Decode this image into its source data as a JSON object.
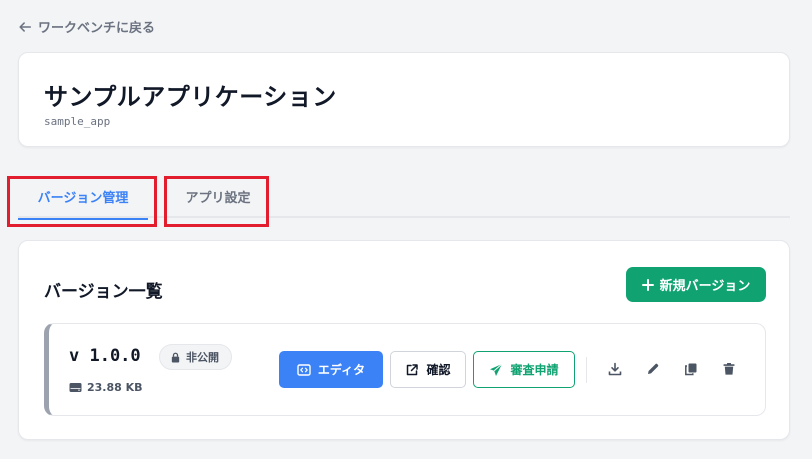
{
  "nav": {
    "back_label": "ワークベンチに戻る"
  },
  "app": {
    "title": "サンプルアプリケーション",
    "id": "sample_app"
  },
  "tabs": [
    {
      "label": "バージョン管理",
      "active": true
    },
    {
      "label": "アプリ設定",
      "active": false
    }
  ],
  "versions_section": {
    "title": "バージョン一覧",
    "new_button_label": "新規バージョン",
    "items": [
      {
        "version": "v 1.0.0",
        "status": "非公開",
        "size": "23.88 KB",
        "actions": {
          "editor": "エディタ",
          "preview": "確認",
          "review": "審査申請"
        }
      }
    ]
  },
  "colors": {
    "primary": "#3b82f6",
    "success": "#10a371",
    "highlight": "#e11d2e",
    "muted": "#6b7280"
  },
  "icons": {
    "back": "arrow-left-icon",
    "plus": "plus-icon",
    "lock": "lock-icon",
    "storage": "hard-drive-icon",
    "editor": "code-icon",
    "preview": "external-link-icon",
    "review": "paper-plane-icon",
    "download": "download-icon",
    "edit": "pencil-icon",
    "copy": "copy-icon",
    "delete": "trash-icon"
  }
}
